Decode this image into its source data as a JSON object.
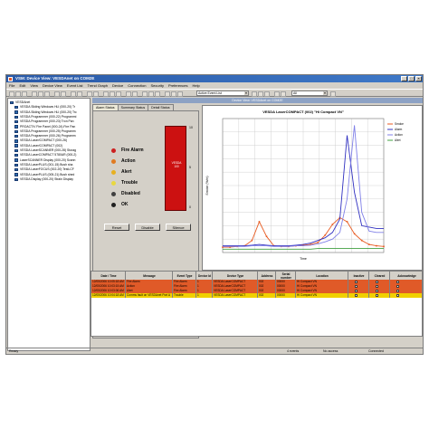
{
  "window": {
    "title": "VSM: Device View: VESDAnet on COM2E",
    "controls": [
      "_",
      "□",
      "×"
    ]
  },
  "menu": [
    "File",
    "Edit",
    "View",
    "Device View",
    "Event List",
    "Trend Graph",
    "Device",
    "Connection",
    "Security",
    "Preferences",
    "Help"
  ],
  "toolbar": {
    "view_combo": "Active Event List",
    "filter_combo": "All"
  },
  "tree": {
    "items": [
      "VESDAnet",
      "VESDA Sliding Windows HLI (000-20) Tr",
      "VESDA Sliding Windows HLI (000-20) Trc",
      "VESDA Programmer (000-22) Programmi",
      "VESDA Programmer (000-23) Tron Pan",
      "PROACTIV Fire Panel (000-24) Fire Pan",
      "VESDA Programmer (000-25) Programm",
      "VESDA Programmer (000-26) Programm",
      "VESDA Laser/COMPACT (000-26)",
      "VESDA Laser/COMPACT (002)",
      "VESDA LaserSCANNER (000-28) Storag",
      "VESDA LaserCOMPACT 5780AR (000-2)",
      "LaserSCANNER Display (000-20) Scann",
      "VESDA LaserPLUS (001-15) Bush sha",
      "VESDA LaserFOCUS (002-20) TestLCF",
      "VESDA LaserPLUS (005-21) Bush shed",
      "VESDA Display (000-20) Strain Display"
    ]
  },
  "device_view_title": "Device View: VESDAnet on COM2E",
  "tabs": [
    "Alarm Status",
    "Summary Status",
    "Detail Status"
  ],
  "status": {
    "indicators": [
      {
        "label": "Fire Alarm",
        "color": "#cc2020"
      },
      {
        "label": "Action",
        "color": "#e07a20"
      },
      {
        "label": "Alert",
        "color": "#e7b020"
      },
      {
        "label": "Trouble",
        "color": "#e8d840"
      },
      {
        "label": "Disabled",
        "color": "#404040"
      },
      {
        "label": "OK",
        "color": "#202020"
      }
    ],
    "bargraph_label": "VESDA 100",
    "bargraph_level_pct": 100,
    "scale": [
      "10",
      "5",
      "0"
    ],
    "buttons": [
      "Reset",
      "Disable",
      "Silence"
    ]
  },
  "chart_data": {
    "type": "line",
    "title": "VESDA LaserCOMPACT (002) \"Hi Compact VN\"",
    "xlabel": "Time",
    "ylabel": "Smoke (%/m)",
    "ylim": [
      0,
      20
    ],
    "colors": {
      "background": "#ffffff",
      "grid": "#c8c8c8"
    },
    "series": [
      {
        "name": "Smoke",
        "color": "#e85a20",
        "values": [
          0.8,
          0.8,
          0.9,
          1.0,
          1.8,
          4.6,
          2.4,
          1.0,
          0.9,
          0.9,
          1.0,
          1.1,
          1.2,
          1.5,
          2.6,
          4.2,
          5.2,
          4.6,
          2.8,
          1.8,
          1.2,
          1.0,
          0.9
        ]
      },
      {
        "name": "Alarm",
        "color": "#3030c0",
        "values": [
          1.0,
          1.0,
          1.0,
          1.0,
          1.1,
          1.2,
          1.1,
          1.0,
          1.0,
          1.0,
          1.1,
          1.2,
          1.4,
          1.8,
          2.2,
          3.0,
          5.0,
          17.5,
          9.0,
          4.0,
          3.8,
          3.6,
          3.6
        ]
      },
      {
        "name": "Action",
        "color": "#8080e8",
        "values": [
          0.9,
          0.9,
          0.9,
          0.9,
          1.0,
          1.0,
          1.0,
          0.9,
          0.9,
          0.9,
          1.0,
          1.0,
          1.1,
          1.3,
          1.6,
          2.0,
          3.0,
          8.0,
          19.0,
          6.0,
          3.2,
          3.0,
          3.0
        ]
      },
      {
        "name": "Alert",
        "color": "#40a040",
        "values": [
          0.5,
          0.5,
          0.5,
          0.5,
          0.5,
          0.5,
          0.5,
          0.5,
          0.5,
          0.5,
          0.5,
          0.5,
          0.5,
          0.6,
          0.6,
          0.6,
          0.6,
          0.6,
          0.6,
          0.6,
          0.6,
          0.6,
          0.6
        ]
      }
    ],
    "legend_position": "right"
  },
  "event_grid": {
    "columns": [
      "Date / Time",
      "Message",
      "Event Type",
      "Device Id",
      "Device Type",
      "Address",
      "Serial number",
      "Location",
      "Inactive",
      "Cleared",
      "Acknowledge"
    ],
    "rows": [
      {
        "cells": [
          "12/05/2006 10:05:18 AM",
          "Fire Alarm",
          "Fire Alarm",
          "1",
          "VESDA LaserCOMPACT",
          "002",
          "00000",
          "Hi Compact VN"
        ],
        "color": "#e05a28"
      },
      {
        "cells": [
          "12/05/2006 10:03:15 AM",
          "Action",
          "Fire Alarm",
          "1",
          "VESDA LaserCOMPACT",
          "002",
          "00000",
          "Hi Compact VN"
        ],
        "color": "#e05a28"
      },
      {
        "cells": [
          "12/05/2006 10:03:06 AM",
          "Alert",
          "Fire Alarm",
          "1",
          "VESDA LaserCOMPACT",
          "002",
          "00000",
          "Hi Compact VN"
        ],
        "color": "#e05a28"
      },
      {
        "cells": [
          "12/05/2006 10:04:18 AM",
          "Comms fault on VESDAnet Port A",
          "Trouble",
          "1",
          "VESDA LaserCOMPACT",
          "002",
          "00000",
          "Hi Compact VN"
        ],
        "color": "#f0d000"
      }
    ]
  },
  "statusbar": {
    "left": "Ready",
    "events": "4 events",
    "access": "No access",
    "connection": "Connected"
  }
}
